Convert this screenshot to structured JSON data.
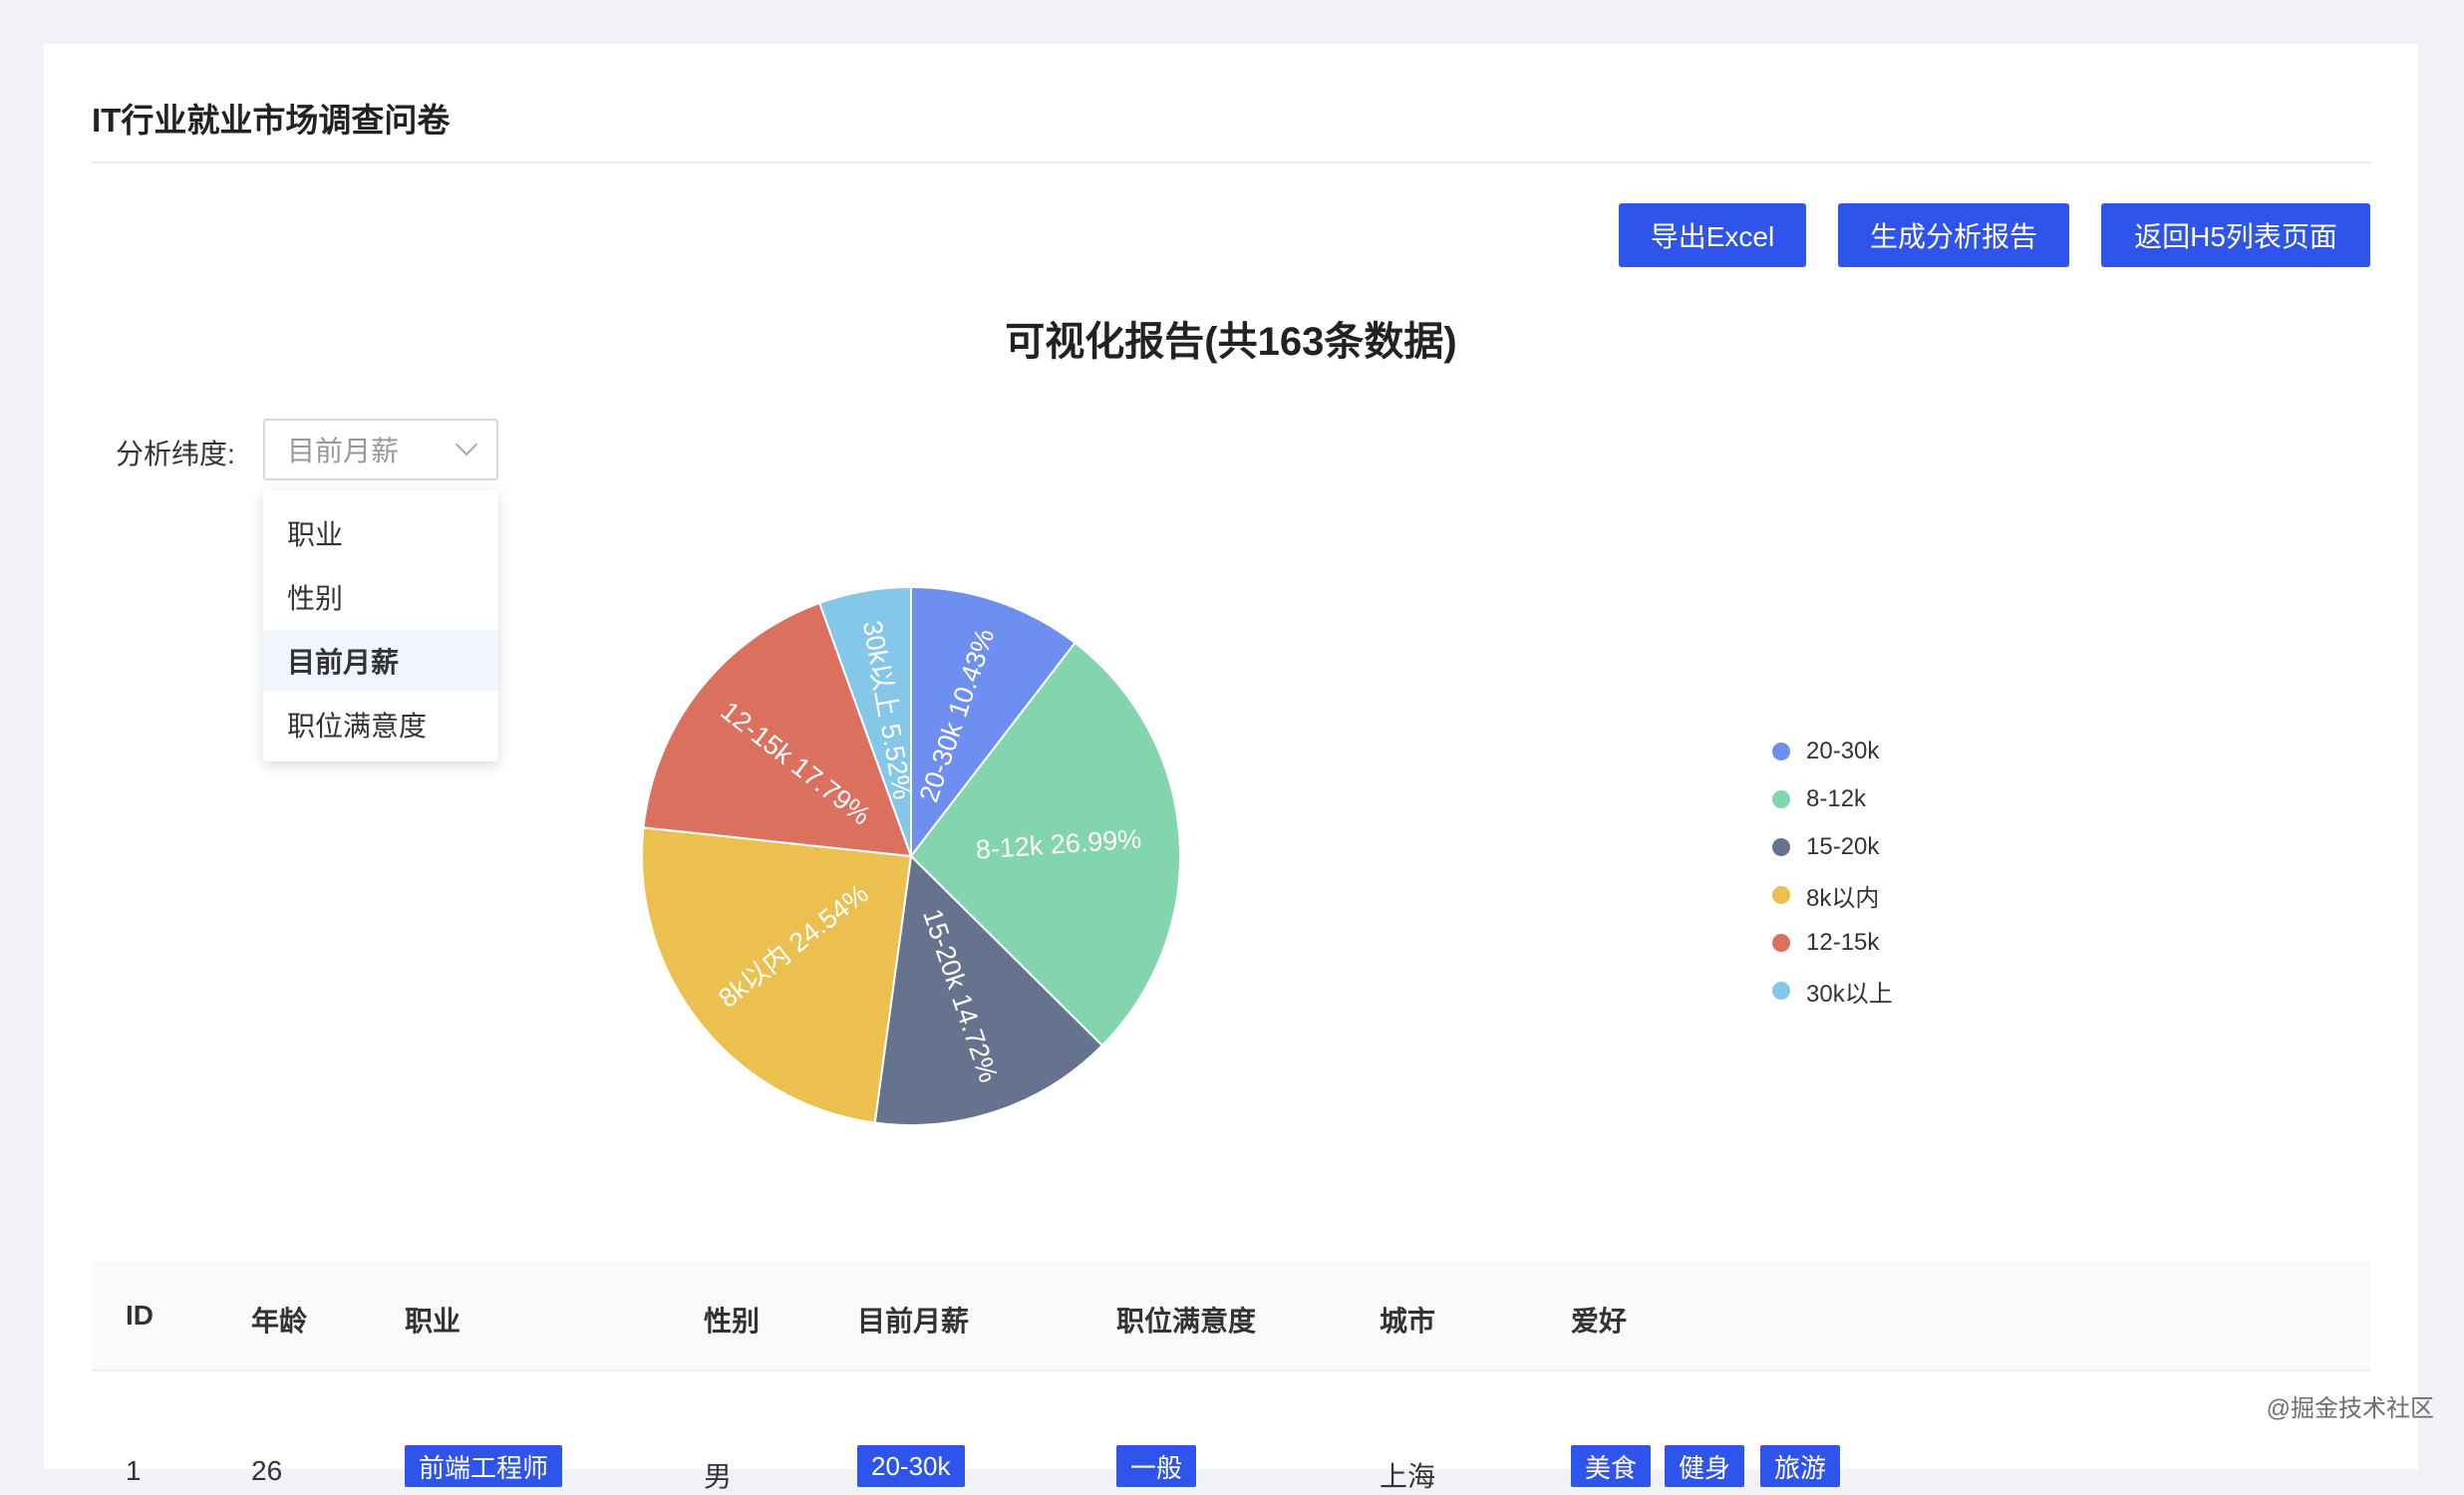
{
  "header": {
    "title": "IT行业就业市场调查问卷"
  },
  "toolbar": {
    "export_label": "导出Excel",
    "report_label": "生成分析报告",
    "back_label": "返回H5列表页面"
  },
  "report": {
    "title": "可视化报告(共163条数据)"
  },
  "filter": {
    "label": "分析纬度:",
    "selected": "目前月薪",
    "options": [
      "职业",
      "性别",
      "目前月薪",
      "职位满意度"
    ]
  },
  "chart_data": {
    "type": "pie",
    "title": "",
    "categories": [
      "20-30k",
      "8-12k",
      "15-20k",
      "8k以内",
      "12-15k",
      "30k以上"
    ],
    "values": [
      10.43,
      26.99,
      14.72,
      24.54,
      17.79,
      5.52
    ],
    "labels": [
      "20-30k 10.43%",
      "8-12k 26.99%",
      "15-20k 14.72%",
      "8k以内 24.54%",
      "12-15k 17.79%",
      "30k以上 5.52%"
    ],
    "colors": [
      "#6e8ff0",
      "#82d5ac",
      "#66738f",
      "#ecc04e",
      "#dc705f",
      "#85c7e8"
    ],
    "legend": "right"
  },
  "table": {
    "headers": [
      "ID",
      "年龄",
      "职业",
      "性别",
      "目前月薪",
      "职位满意度",
      "城市",
      "爱好"
    ],
    "rows": [
      {
        "id": "1",
        "age": "26",
        "job": "前端工程师",
        "gender": "男",
        "salary": "20-30k",
        "satisfaction": "一般",
        "city": "上海",
        "hobbies": [
          "美食",
          "健身",
          "旅游"
        ]
      }
    ]
  },
  "watermark": "@掘金技术社区"
}
